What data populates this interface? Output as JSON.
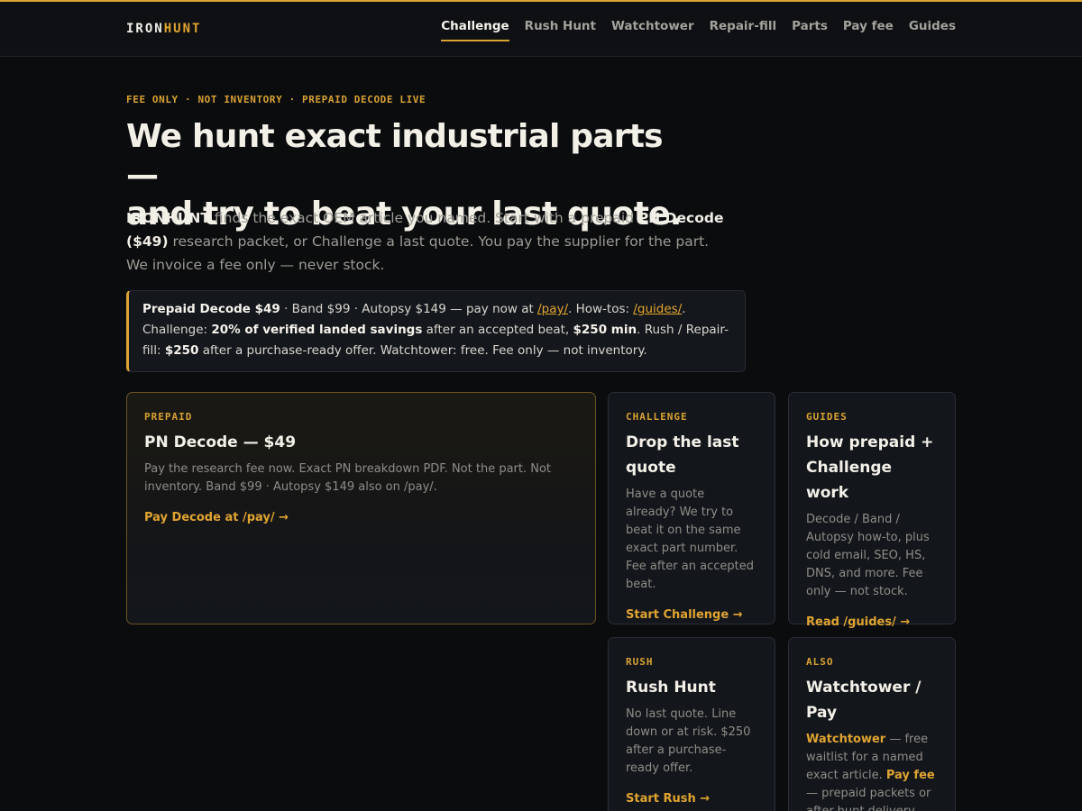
{
  "header": {
    "brand_main": "IRON",
    "brand_accent": "HUNT",
    "nav": [
      {
        "label": "Challenge",
        "active": true
      },
      {
        "label": "Rush Hunt"
      },
      {
        "label": "Watchtower"
      },
      {
        "label": "Repair-fill"
      },
      {
        "label": "Parts"
      },
      {
        "label": "Pay fee"
      },
      {
        "label": "Guides"
      }
    ]
  },
  "hero": {
    "eyebrow": "FEE ONLY · NOT INVENTORY · PREPAID DECODE LIVE",
    "title_line1": "We hunt exact industrial parts —",
    "title_line2": "and try to beat your last quote.",
    "lead": {
      "brand": "IRONHUNT",
      "t1": " finds the exact OEM article you named. Start with a prepaid ",
      "decode": "PN Decode ($49)",
      "t2": " research packet, or Challenge a last quote. You pay the supplier for the part. We invoice a fee only — never stock."
    }
  },
  "notice": {
    "prepaid": "Prepaid Decode $49",
    "t1": " · Band $99 · Autopsy $149 — pay now at ",
    "pay_link": "/pay/",
    "t2": ". How-tos: ",
    "guides_link": "/guides/",
    "t3": ". Challenge: ",
    "savings": "20% of verified landed savings",
    "t4": " after an accepted beat, ",
    "min": "$250 min",
    "t5": ". Rush / Repair-fill: ",
    "fee": "$250",
    "t6": " after a purchase-ready offer. Watchtower: free. Fee only — not inventory."
  },
  "cards": {
    "prepaid": {
      "kicker": "PREPAID",
      "title": "PN Decode — $49",
      "desc": "Pay the research fee now. Exact PN breakdown PDF. Not the part. Not inventory. Band $99 · Autopsy $149 also on /pay/.",
      "cta": "Pay Decode at /pay/ →"
    },
    "challenge": {
      "kicker": "CHALLENGE",
      "title": "Drop the last quote",
      "desc": "Have a quote already? We try to beat it on the same exact part number. Fee after an accepted beat.",
      "cta": "Start Challenge →"
    },
    "guides": {
      "kicker": "GUIDES",
      "title": "How prepaid + Challenge work",
      "desc": "Decode / Band / Autopsy how-to, plus cold email, SEO, HS, DNS, and more. Fee only — not stock.",
      "cta": "Read /guides/ →"
    },
    "rush": {
      "kicker": "RUSH",
      "title": "Rush Hunt",
      "desc": "No last quote. Line down or at risk. $250 after a purchase-ready offer.",
      "cta": "Start Rush →"
    },
    "also": {
      "kicker": "ALSO",
      "title": "Watchtower / Pay",
      "watchtower": "Watchtower",
      "t1": " — free waitlist for a named exact article. ",
      "payfee": "Pay fee",
      "t2": " — prepaid packets or after-hunt delivery."
    }
  }
}
